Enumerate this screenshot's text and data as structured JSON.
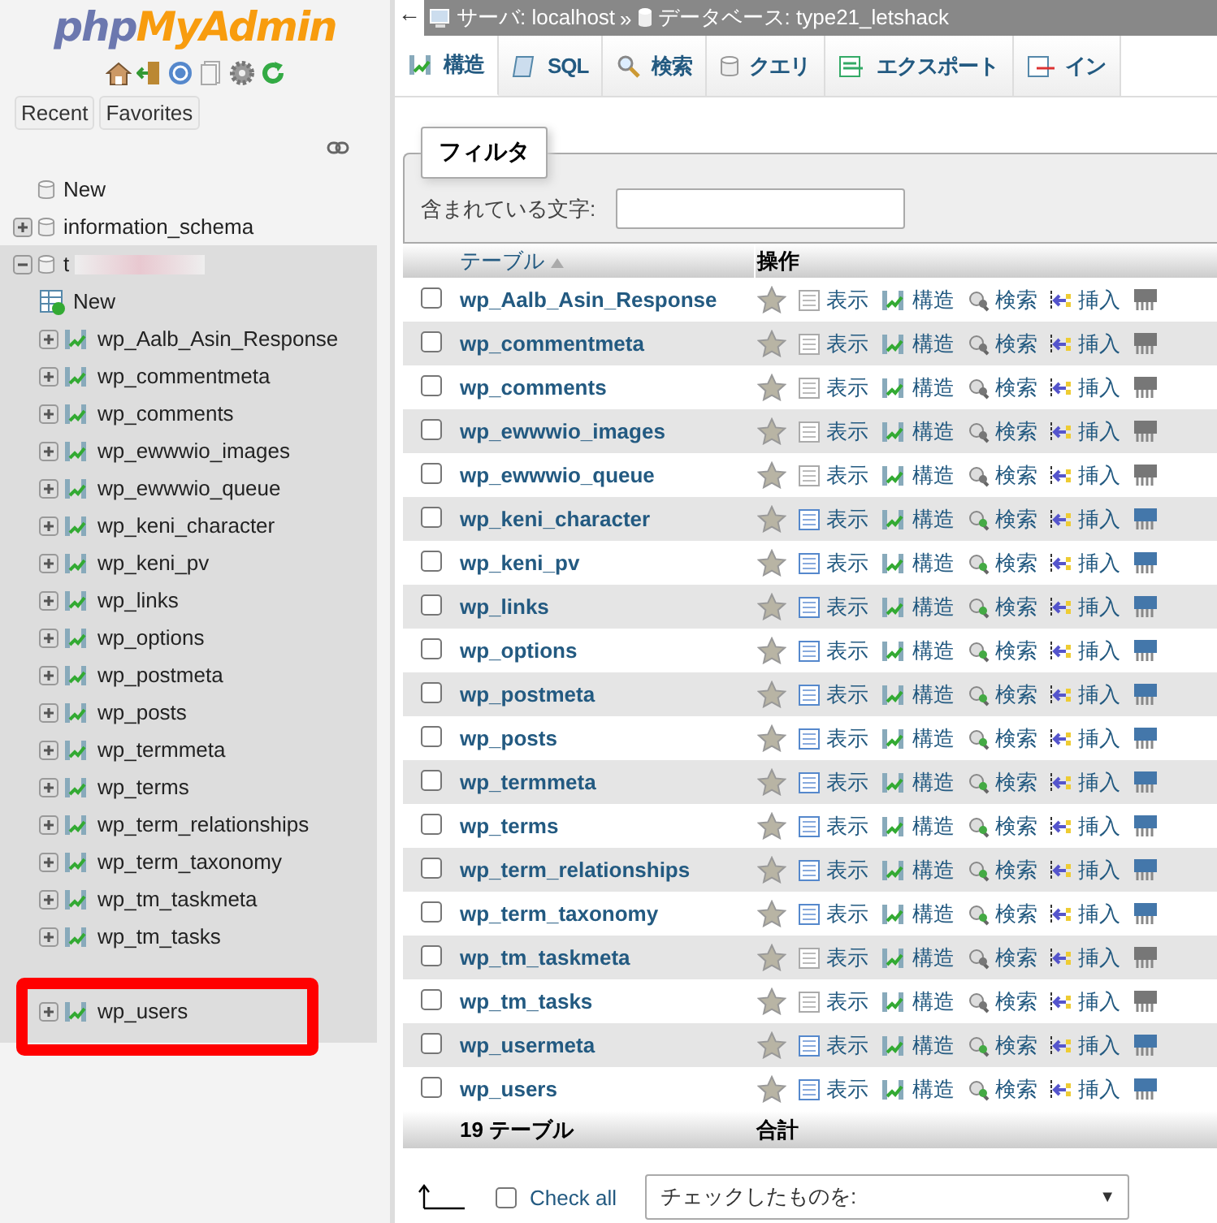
{
  "logo": {
    "part1": "php",
    "part2": "MyAdmin"
  },
  "nav_buttons": [
    "Recent",
    "Favorites"
  ],
  "tree": [
    {
      "label": "New",
      "kind": "new",
      "expanded": false
    },
    {
      "label": "information_schema",
      "kind": "db",
      "expanded": false
    },
    {
      "label": "t",
      "kind": "db",
      "expanded": true,
      "children": [
        {
          "label": "New",
          "kind": "new-table",
          "highlighted": false
        },
        {
          "label": "wp_Aalb_Asin_Response",
          "kind": "table",
          "highlighted": false
        },
        {
          "label": "wp_commentmeta",
          "kind": "table",
          "highlighted": false
        },
        {
          "label": "wp_comments",
          "kind": "table",
          "highlighted": false
        },
        {
          "label": "wp_ewwwio_images",
          "kind": "table",
          "highlighted": false
        },
        {
          "label": "wp_ewwwio_queue",
          "kind": "table",
          "highlighted": false
        },
        {
          "label": "wp_keni_character",
          "kind": "table",
          "highlighted": false
        },
        {
          "label": "wp_keni_pv",
          "kind": "table",
          "highlighted": false
        },
        {
          "label": "wp_links",
          "kind": "table",
          "highlighted": false
        },
        {
          "label": "wp_options",
          "kind": "table",
          "highlighted": false
        },
        {
          "label": "wp_postmeta",
          "kind": "table",
          "highlighted": false
        },
        {
          "label": "wp_posts",
          "kind": "table",
          "highlighted": false
        },
        {
          "label": "wp_termmeta",
          "kind": "table",
          "highlighted": false
        },
        {
          "label": "wp_terms",
          "kind": "table",
          "highlighted": false
        },
        {
          "label": "wp_term_relationships",
          "kind": "table",
          "highlighted": false
        },
        {
          "label": "wp_term_taxonomy",
          "kind": "table",
          "highlighted": false
        },
        {
          "label": "wp_tm_taskmeta",
          "kind": "table",
          "highlighted": false
        },
        {
          "label": "wp_tm_tasks",
          "kind": "table",
          "highlighted": false
        },
        {
          "kind": "covered",
          "highlighted": false
        },
        {
          "label": "wp_users",
          "kind": "table",
          "highlighted": true
        }
      ]
    }
  ],
  "breadcrumb": {
    "back": "←",
    "server": "サーバ: localhost",
    "sep": "»",
    "database": "データベース: type21_letshack"
  },
  "tabs": [
    {
      "label": "構造",
      "kind": "structure",
      "selected": true
    },
    {
      "label": "SQL",
      "kind": "sql",
      "selected": false
    },
    {
      "label": "検索",
      "kind": "search",
      "selected": false
    },
    {
      "label": "クエリ",
      "kind": "query",
      "selected": false
    },
    {
      "label": "エクスポート",
      "kind": "export",
      "selected": false
    },
    {
      "label": "イン",
      "kind": "import",
      "selected": false
    }
  ],
  "filter": {
    "legend": "フィルタ",
    "label": "含まれている文字:"
  },
  "table": {
    "columns": [
      "テーブル",
      "操作"
    ],
    "rows": [
      {
        "name": "wp_Aalb_Asin_Response",
        "empty": true,
        "checked": false,
        "actions": [
          "表示",
          "構造",
          "検索",
          "挿入"
        ]
      },
      {
        "name": "wp_commentmeta",
        "empty": true,
        "checked": false,
        "actions": [
          "表示",
          "構造",
          "検索",
          "挿入"
        ]
      },
      {
        "name": "wp_comments",
        "empty": true,
        "checked": false,
        "actions": [
          "表示",
          "構造",
          "検索",
          "挿入"
        ]
      },
      {
        "name": "wp_ewwwio_images",
        "empty": true,
        "checked": false,
        "actions": [
          "表示",
          "構造",
          "検索",
          "挿入"
        ]
      },
      {
        "name": "wp_ewwwio_queue",
        "empty": true,
        "checked": false,
        "actions": [
          "表示",
          "構造",
          "検索",
          "挿入"
        ]
      },
      {
        "name": "wp_keni_character",
        "empty": false,
        "checked": false,
        "actions": [
          "表示",
          "構造",
          "検索",
          "挿入"
        ]
      },
      {
        "name": "wp_keni_pv",
        "empty": false,
        "checked": false,
        "actions": [
          "表示",
          "構造",
          "検索",
          "挿入"
        ]
      },
      {
        "name": "wp_links",
        "empty": false,
        "checked": false,
        "actions": [
          "表示",
          "構造",
          "検索",
          "挿入"
        ]
      },
      {
        "name": "wp_options",
        "empty": false,
        "checked": false,
        "actions": [
          "表示",
          "構造",
          "検索",
          "挿入"
        ]
      },
      {
        "name": "wp_postmeta",
        "empty": false,
        "checked": false,
        "actions": [
          "表示",
          "構造",
          "検索",
          "挿入"
        ]
      },
      {
        "name": "wp_posts",
        "empty": false,
        "checked": false,
        "actions": [
          "表示",
          "構造",
          "検索",
          "挿入"
        ]
      },
      {
        "name": "wp_termmeta",
        "empty": false,
        "checked": false,
        "actions": [
          "表示",
          "構造",
          "検索",
          "挿入"
        ]
      },
      {
        "name": "wp_terms",
        "empty": false,
        "checked": false,
        "actions": [
          "表示",
          "構造",
          "検索",
          "挿入"
        ]
      },
      {
        "name": "wp_term_relationships",
        "empty": false,
        "checked": false,
        "actions": [
          "表示",
          "構造",
          "検索",
          "挿入"
        ]
      },
      {
        "name": "wp_term_taxonomy",
        "empty": false,
        "checked": false,
        "actions": [
          "表示",
          "構造",
          "検索",
          "挿入"
        ]
      },
      {
        "name": "wp_tm_taskmeta",
        "empty": true,
        "checked": false,
        "actions": [
          "表示",
          "構造",
          "検索",
          "挿入"
        ]
      },
      {
        "name": "wp_tm_tasks",
        "empty": true,
        "checked": false,
        "actions": [
          "表示",
          "構造",
          "検索",
          "挿入"
        ]
      },
      {
        "name": "wp_usermeta",
        "empty": false,
        "checked": false,
        "actions": [
          "表示",
          "構造",
          "検索",
          "挿入"
        ]
      },
      {
        "name": "wp_users",
        "empty": false,
        "checked": false,
        "actions": [
          "表示",
          "構造",
          "検索",
          "挿入"
        ]
      }
    ],
    "footer": [
      "19 テーブル",
      "合計"
    ]
  },
  "bulk": {
    "check_all": "Check all",
    "checked": false,
    "select": "チェックしたものを:",
    "caret": "▼"
  }
}
